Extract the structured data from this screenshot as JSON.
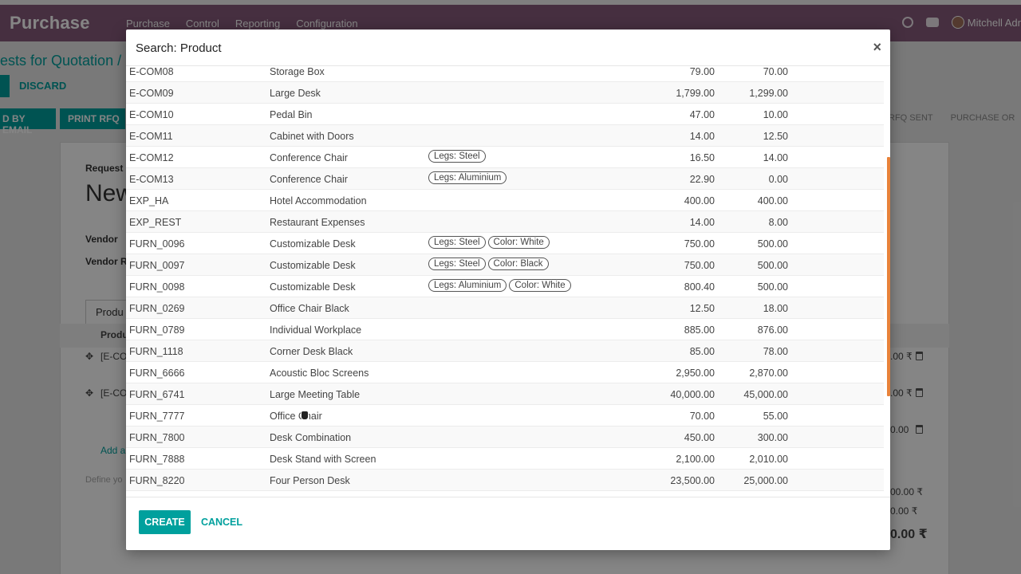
{
  "app": {
    "title": "Purchase",
    "menu": [
      "Purchase",
      "Control",
      "Reporting",
      "Configuration"
    ],
    "user": "Mitchell Adr"
  },
  "background": {
    "breadcrumb": "ests for Quotation /",
    "discard_label": "DISCARD",
    "send_email_label": "D BY EMAIL",
    "print_rfq_label": "PRINT RFQ",
    "status_steps": [
      "RFQ SENT",
      "PURCHASE OR"
    ],
    "request_label": "Request",
    "record_name": "New",
    "vendor_label": "Vendor",
    "vendor_ref_label": "Vendor R",
    "tab_label": "Produ",
    "col_product": "Produ",
    "line1": "[E-CO",
    "line2": "[E-CO",
    "add_line": "Add a",
    "define": "Define yo",
    "amounts": [
      ".00 ₹",
      ".00 ₹",
      "0.00",
      "00.00 ₹",
      "0.00 ₹",
      "0.00 ₹"
    ]
  },
  "modal": {
    "title": "Search: Product",
    "close_symbol": "×",
    "create_label": "CREATE",
    "cancel_label": "CANCEL",
    "rows": [
      {
        "ref": "E-COM08",
        "name": "Storage Box",
        "attrs": [],
        "price": "79.00",
        "cost": "70.00"
      },
      {
        "ref": "E-COM09",
        "name": "Large Desk",
        "attrs": [],
        "price": "1,799.00",
        "cost": "1,299.00"
      },
      {
        "ref": "E-COM10",
        "name": "Pedal Bin",
        "attrs": [],
        "price": "47.00",
        "cost": "10.00"
      },
      {
        "ref": "E-COM11",
        "name": "Cabinet with Doors",
        "attrs": [],
        "price": "14.00",
        "cost": "12.50"
      },
      {
        "ref": "E-COM12",
        "name": "Conference Chair",
        "attrs": [
          "Legs: Steel"
        ],
        "price": "16.50",
        "cost": "14.00"
      },
      {
        "ref": "E-COM13",
        "name": "Conference Chair",
        "attrs": [
          "Legs: Aluminium"
        ],
        "price": "22.90",
        "cost": "0.00"
      },
      {
        "ref": "EXP_HA",
        "name": "Hotel Accommodation",
        "attrs": [],
        "price": "400.00",
        "cost": "400.00"
      },
      {
        "ref": "EXP_REST",
        "name": "Restaurant Expenses",
        "attrs": [],
        "price": "14.00",
        "cost": "8.00"
      },
      {
        "ref": "FURN_0096",
        "name": "Customizable Desk",
        "attrs": [
          "Legs: Steel",
          "Color: White"
        ],
        "price": "750.00",
        "cost": "500.00"
      },
      {
        "ref": "FURN_0097",
        "name": "Customizable Desk",
        "attrs": [
          "Legs: Steel",
          "Color: Black"
        ],
        "price": "750.00",
        "cost": "500.00"
      },
      {
        "ref": "FURN_0098",
        "name": "Customizable Desk",
        "attrs": [
          "Legs: Aluminium",
          "Color: White"
        ],
        "price": "800.40",
        "cost": "500.00"
      },
      {
        "ref": "FURN_0269",
        "name": "Office Chair Black",
        "attrs": [],
        "price": "12.50",
        "cost": "18.00"
      },
      {
        "ref": "FURN_0789",
        "name": "Individual Workplace",
        "attrs": [],
        "price": "885.00",
        "cost": "876.00"
      },
      {
        "ref": "FURN_1118",
        "name": "Corner Desk Black",
        "attrs": [],
        "price": "85.00",
        "cost": "78.00"
      },
      {
        "ref": "FURN_6666",
        "name": "Acoustic Bloc Screens",
        "attrs": [],
        "price": "2,950.00",
        "cost": "2,870.00"
      },
      {
        "ref": "FURN_6741",
        "name": "Large Meeting Table",
        "attrs": [],
        "price": "40,000.00",
        "cost": "45,000.00"
      },
      {
        "ref": "FURN_7777",
        "name": "Office Chair",
        "attrs": [],
        "price": "70.00",
        "cost": "55.00"
      },
      {
        "ref": "FURN_7800",
        "name": "Desk Combination",
        "attrs": [],
        "price": "450.00",
        "cost": "300.00"
      },
      {
        "ref": "FURN_7888",
        "name": "Desk Stand with Screen",
        "attrs": [],
        "price": "2,100.00",
        "cost": "2,010.00"
      },
      {
        "ref": "FURN_8220",
        "name": "Four Person Desk",
        "attrs": [],
        "price": "23,500.00",
        "cost": "25,000.00"
      }
    ]
  },
  "colors": {
    "brand": "#875a7b",
    "primary": "#00a09d",
    "scrollbar": "#e8823a"
  }
}
